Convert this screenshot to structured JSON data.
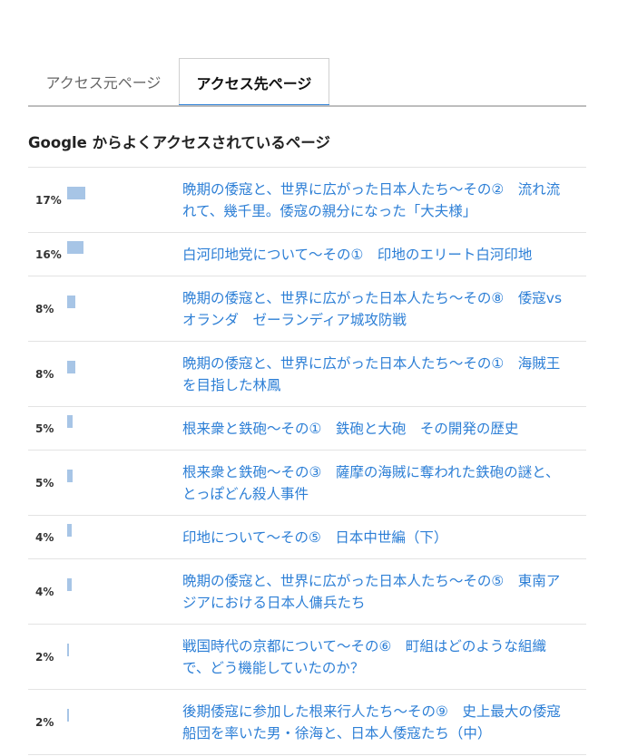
{
  "tabs": [
    {
      "label": "アクセス元ページ",
      "active": false
    },
    {
      "label": "アクセス先ページ",
      "active": true
    }
  ],
  "heading": "Google からよくアクセスされているページ",
  "accent_color": "#2d7fd6",
  "bar_color": "#a7c5e6",
  "rows": [
    {
      "percent": "17%",
      "share": 17,
      "title": "晩期の倭寇と、世界に広がった日本人たち〜その②　流れ流れて、幾千里。倭寇の親分になった「大夫様」"
    },
    {
      "percent": "16%",
      "share": 16,
      "title": "白河印地党について〜その①　印地のエリート白河印地"
    },
    {
      "percent": "8%",
      "share": 8,
      "title": "晩期の倭寇と、世界に広がった日本人たち〜その⑧　倭寇vsオランダ　ゼーランディア城攻防戦"
    },
    {
      "percent": "8%",
      "share": 8,
      "title": "晩期の倭寇と、世界に広がった日本人たち〜その①　海賊王を目指した林鳳"
    },
    {
      "percent": "5%",
      "share": 5,
      "title": "根来衆と鉄砲〜その①　鉄砲と大砲　その開発の歴史"
    },
    {
      "percent": "5%",
      "share": 5,
      "title": "根来衆と鉄砲〜その③　薩摩の海賊に奪われた鉄砲の謎と、とっぽどん殺人事件"
    },
    {
      "percent": "4%",
      "share": 4,
      "title": "印地について〜その⑤　日本中世編（下）"
    },
    {
      "percent": "4%",
      "share": 4,
      "title": "晩期の倭寇と、世界に広がった日本人たち〜その⑤　東南アジアにおける日本人傭兵たち"
    },
    {
      "percent": "2%",
      "share": 2,
      "title": "戦国時代の京都について〜その⑥　町組はどのような組織で、どう機能していたのか？"
    },
    {
      "percent": "2%",
      "share": 2,
      "title": "後期倭寇に参加した根来行人たち〜その⑨　史上最大の倭寇船団を率いた男・徐海と、日本人倭寇たち（中）"
    }
  ]
}
